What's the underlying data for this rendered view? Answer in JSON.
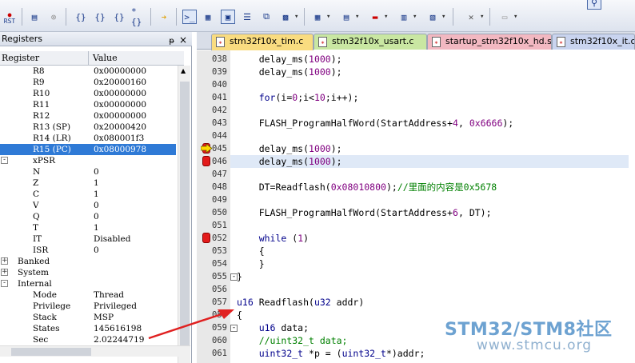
{
  "toolbar": {
    "icons": [
      "rst-icon",
      "reset-icon",
      "stop-icon",
      "step-into-icon",
      "step-over-icon",
      "step-out-icon",
      "run-to-cursor-icon",
      "show-next-statement-icon",
      "command-window-icon",
      "disassembly-icon",
      "symbols-icon",
      "registers-icon",
      "call-stack-icon",
      "watch-icon",
      "memory-icon",
      "serial-icon",
      "analysis-icon",
      "trace-icon",
      "system-viewer-icon",
      "toolbox-icon",
      "window-icon"
    ],
    "rst_label": "RST",
    "step_labels": [
      "{}",
      "{}",
      "{}",
      "*{}"
    ]
  },
  "registers": {
    "title": "Registers",
    "pin": "ᵽ",
    "close": "×",
    "col_register": "Register",
    "col_value": "Value",
    "rows": [
      {
        "name": "R8",
        "value": "0x00000000",
        "indent": 2
      },
      {
        "name": "R9",
        "value": "0x20000160",
        "indent": 2
      },
      {
        "name": "R10",
        "value": "0x00000000",
        "indent": 2
      },
      {
        "name": "R11",
        "value": "0x00000000",
        "indent": 2
      },
      {
        "name": "R12",
        "value": "0x00000000",
        "indent": 2
      },
      {
        "name": "R13 (SP)",
        "value": "0x20000420",
        "indent": 2
      },
      {
        "name": "R14 (LR)",
        "value": "0x080001f3",
        "indent": 2
      },
      {
        "name": "R15 (PC)",
        "value": "0x08000978",
        "indent": 2,
        "selected": true
      },
      {
        "name": "xPSR",
        "value": "",
        "indent": 2,
        "expander": "-"
      },
      {
        "name": "N",
        "value": "0",
        "indent": 3
      },
      {
        "name": "Z",
        "value": "1",
        "indent": 3
      },
      {
        "name": "C",
        "value": "1",
        "indent": 3
      },
      {
        "name": "V",
        "value": "0",
        "indent": 3
      },
      {
        "name": "Q",
        "value": "0",
        "indent": 3
      },
      {
        "name": "T",
        "value": "1",
        "indent": 3
      },
      {
        "name": "IT",
        "value": "Disabled",
        "indent": 3
      },
      {
        "name": "ISR",
        "value": "0",
        "indent": 3
      },
      {
        "name": "Banked",
        "value": "",
        "indent": 1,
        "expander": "+"
      },
      {
        "name": "System",
        "value": "",
        "indent": 1,
        "expander": "+"
      },
      {
        "name": "Internal",
        "value": "",
        "indent": 1,
        "expander": "-"
      },
      {
        "name": "Mode",
        "value": "Thread",
        "indent": 2
      },
      {
        "name": "Privilege",
        "value": "Privileged",
        "indent": 2
      },
      {
        "name": "Stack",
        "value": "MSP",
        "indent": 2
      },
      {
        "name": "States",
        "value": "145616198",
        "indent": 2
      },
      {
        "name": "Sec",
        "value": "2.02244719",
        "indent": 2
      }
    ]
  },
  "tabs": [
    {
      "label": "stm32f10x_tim.c",
      "active": true,
      "color": "#f7d77a"
    },
    {
      "label": "stm32f10x_usart.c",
      "active": false,
      "color": "#c9e7a2"
    },
    {
      "label": "startup_stm32f10x_hd.s",
      "active": false,
      "color": "#f2b8c1"
    },
    {
      "label": "stm32f10x_it.c",
      "active": false,
      "color": "#c9d4ef"
    }
  ],
  "code": [
    {
      "ln": "038",
      "text": "    delay_ms(1000);"
    },
    {
      "ln": "039",
      "text": "    delay_ms(1000);"
    },
    {
      "ln": "040",
      "text": ""
    },
    {
      "ln": "041",
      "text": "    for(i=0;i<10;i++);"
    },
    {
      "ln": "042",
      "text": ""
    },
    {
      "ln": "043",
      "text": "    FLASH_ProgramHalfWord(StartAddress+4, 0x6666);"
    },
    {
      "ln": "044",
      "text": ""
    },
    {
      "ln": "045",
      "text": "    delay_ms(1000);",
      "marker": "arrow"
    },
    {
      "ln": "046",
      "text": "    delay_ms(1000);",
      "marker": "bp",
      "highlight": true
    },
    {
      "ln": "047",
      "text": ""
    },
    {
      "ln": "048",
      "text": "    DT=Readflash(0x08010800);//里面的内容是0x5678"
    },
    {
      "ln": "049",
      "text": ""
    },
    {
      "ln": "050",
      "text": "    FLASH_ProgramHalfWord(StartAddress+6, DT);"
    },
    {
      "ln": "051",
      "text": ""
    },
    {
      "ln": "052",
      "text": "    while (1)",
      "marker": "bp"
    },
    {
      "ln": "053",
      "text": "    {"
    },
    {
      "ln": "054",
      "text": "    }"
    },
    {
      "ln": "055",
      "text": "}"
    },
    {
      "ln": "056",
      "text": ""
    },
    {
      "ln": "057",
      "text": "u16 Readflash(u32 addr)"
    },
    {
      "ln": "058",
      "text": "{"
    },
    {
      "ln": "059",
      "text": "    u16 data;"
    },
    {
      "ln": "060",
      "text": "    //uint32_t data;"
    },
    {
      "ln": "061",
      "text": "    uint32_t *p = (uint32_t*)addr;"
    }
  ],
  "watermark": {
    "line1": "STM32/STM8社区",
    "line2": "www.stmcu.org"
  },
  "annotation_arrow_color": "#e02020"
}
